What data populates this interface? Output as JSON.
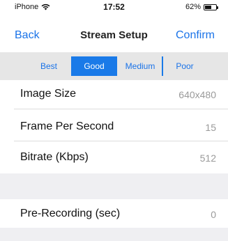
{
  "status_bar": {
    "carrier": "iPhone",
    "time": "17:52",
    "battery_percent": "62%",
    "battery_level": 0.62
  },
  "nav": {
    "back_label": "Back",
    "title": "Stream Setup",
    "confirm_label": "Confirm",
    "accent_color": "#1a73e8"
  },
  "quality_segments": {
    "options": [
      "Best",
      "Good",
      "Medium",
      "Poor"
    ],
    "selected": "Good"
  },
  "settings": {
    "image_size": {
      "label": "Image Size",
      "value": "640x480"
    },
    "fps": {
      "label": "Frame Per Second",
      "value": "15"
    },
    "bitrate": {
      "label": "Bitrate (Kbps)",
      "value": "512"
    },
    "pre_recording": {
      "label": "Pre-Recording (sec)",
      "value": "0"
    }
  },
  "icons": {
    "wifi": "wifi-icon",
    "battery": "battery-icon"
  }
}
